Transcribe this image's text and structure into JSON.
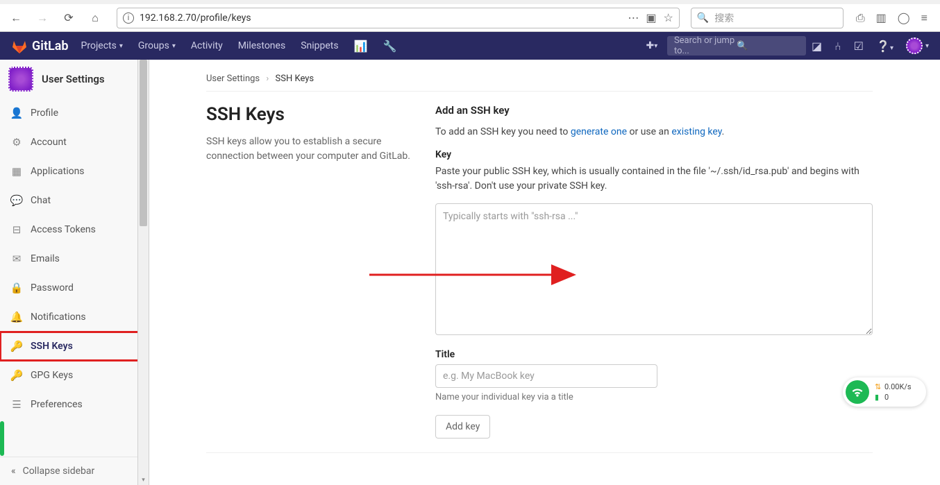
{
  "browser": {
    "url": "192.168.2.70/profile/keys",
    "search_placeholder": "搜索"
  },
  "gl_header": {
    "brand": "GitLab",
    "nav": {
      "projects": "Projects",
      "groups": "Groups",
      "activity": "Activity",
      "milestones": "Milestones",
      "snippets": "Snippets"
    },
    "search_placeholder": "Search or jump to..."
  },
  "sidebar": {
    "title": "User Settings",
    "items": [
      {
        "label": "Profile",
        "icon": "👤"
      },
      {
        "label": "Account",
        "icon": "⚙"
      },
      {
        "label": "Applications",
        "icon": "▦"
      },
      {
        "label": "Chat",
        "icon": "💬"
      },
      {
        "label": "Access Tokens",
        "icon": "⊟"
      },
      {
        "label": "Emails",
        "icon": "✉"
      },
      {
        "label": "Password",
        "icon": "🔒"
      },
      {
        "label": "Notifications",
        "icon": "🔔"
      },
      {
        "label": "SSH Keys",
        "icon": "🔑"
      },
      {
        "label": "GPG Keys",
        "icon": "🔑"
      },
      {
        "label": "Preferences",
        "icon": "☰"
      }
    ],
    "collapse": "Collapse sidebar"
  },
  "breadcrumb": {
    "root": "User Settings",
    "current": "SSH Keys"
  },
  "page": {
    "heading": "SSH Keys",
    "subdesc": "SSH keys allow you to establish a secure connection between your computer and GitLab.",
    "add_heading": "Add an SSH key",
    "add_text_pre": "To add an SSH key you need to ",
    "link_generate": "generate one",
    "add_text_mid": " or use an ",
    "link_existing": "existing key",
    "add_text_post": ".",
    "key_label": "Key",
    "key_help": "Paste your public SSH key, which is usually contained in the file '~/.ssh/id_rsa.pub' and begins with 'ssh-rsa'. Don't use your private SSH key.",
    "key_placeholder": "Typically starts with \"ssh-rsa ...\"",
    "title_label": "Title",
    "title_placeholder": "e.g. My MacBook key",
    "title_hint": "Name your individual key via a title",
    "add_btn": "Add key"
  },
  "net": {
    "speed": "0.00K/s",
    "data": "0"
  }
}
